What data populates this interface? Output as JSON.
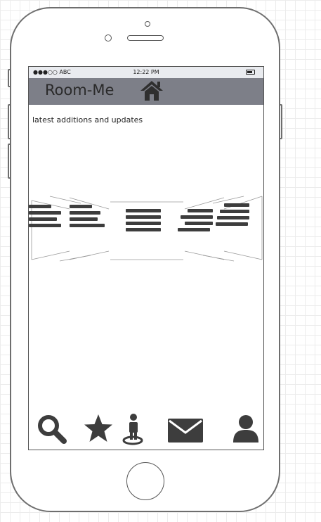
{
  "status_bar": {
    "carrier": "●●●○○ ABC",
    "time": "12:22 PM"
  },
  "app_bar": {
    "title": "Room-Me",
    "home_icon": "home-icon"
  },
  "content": {
    "heading": "latest additions and updates"
  },
  "carousel": {
    "item_icon": "menu-lines-icon"
  },
  "tab_bar": {
    "items": [
      {
        "name": "search",
        "icon": "search-icon"
      },
      {
        "name": "favorites",
        "icon": "star-icon"
      },
      {
        "name": "location",
        "icon": "person-location-icon"
      },
      {
        "name": "messages",
        "icon": "envelope-icon"
      },
      {
        "name": "profile",
        "icon": "user-icon"
      }
    ]
  },
  "colors": {
    "app_bar": "#7d7f88",
    "status_bar": "#e9ebef",
    "icons": "#3d3d3d"
  }
}
